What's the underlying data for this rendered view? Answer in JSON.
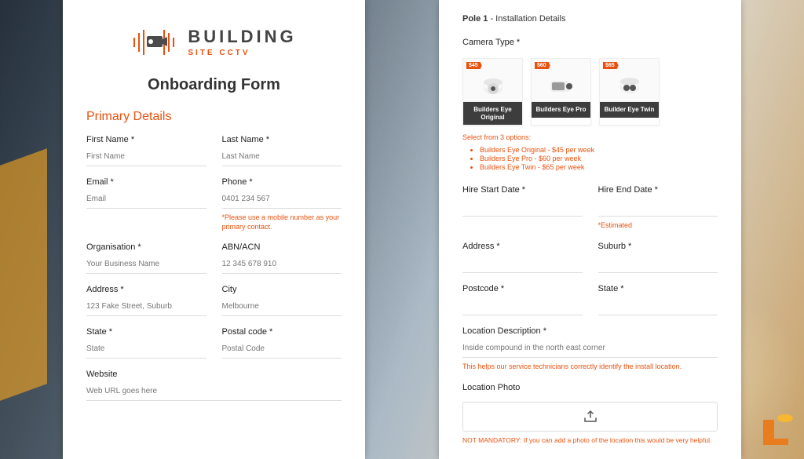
{
  "brand": {
    "line1": "BUILDING",
    "line2_a": "SITE ",
    "line2_b": "CCTV"
  },
  "page_title": "Onboarding Form",
  "left": {
    "section": "Primary Details",
    "fields": {
      "first_name": {
        "label": "First Name *",
        "placeholder": "First Name"
      },
      "last_name": {
        "label": "Last Name *",
        "placeholder": "Last Name"
      },
      "email": {
        "label": "Email *",
        "placeholder": "Email"
      },
      "phone": {
        "label": "Phone *",
        "placeholder": "0401 234 567",
        "helper": "*Please use a mobile number as your primary contact."
      },
      "organisation": {
        "label": "Organisation *",
        "placeholder": "Your Business Name"
      },
      "abn": {
        "label": "ABN/ACN",
        "placeholder": "12 345 678 910"
      },
      "address": {
        "label": "Address *",
        "placeholder": "123 Fake Street, Suburb"
      },
      "city": {
        "label": "City",
        "placeholder": "Melbourne"
      },
      "state": {
        "label": "State *",
        "placeholder": "State"
      },
      "postal": {
        "label": "Postal code *",
        "placeholder": "Postal Code"
      },
      "website": {
        "label": "Website",
        "placeholder": "Web URL goes here"
      }
    }
  },
  "right": {
    "pole_header_a": "Pole 1",
    "pole_header_b": " - Installation Details",
    "camera_type_label": "Camera Type *",
    "cameras": [
      {
        "name": "Builders Eye Original",
        "price": "$45"
      },
      {
        "name": "Builders Eye Pro",
        "price": "$60"
      },
      {
        "name": "Builder Eye Twin",
        "price": "$65"
      }
    ],
    "select_note": "Select from 3 options:",
    "price_list": [
      "Builders Eye Original - $45 per week",
      "Builders Eye Pro - $60 per week",
      "Builders Eye Twin - $65 per week"
    ],
    "fields": {
      "hire_start": {
        "label": "Hire Start Date *"
      },
      "hire_end": {
        "label": "Hire End Date *",
        "helper": "*Estimated"
      },
      "address": {
        "label": "Address *"
      },
      "suburb": {
        "label": "Suburb *"
      },
      "postcode": {
        "label": "Postcode *"
      },
      "state": {
        "label": "State *"
      },
      "loc_desc": {
        "label": "Location Description *",
        "placeholder": "Inside compound in the north east corner",
        "helper": "This helps our service technicians correctly identify the install location."
      },
      "loc_photo": {
        "label": "Location Photo",
        "not_mandatory": "NOT MANDATORY: If you can add a photo of the location this would be very helpful."
      }
    }
  }
}
